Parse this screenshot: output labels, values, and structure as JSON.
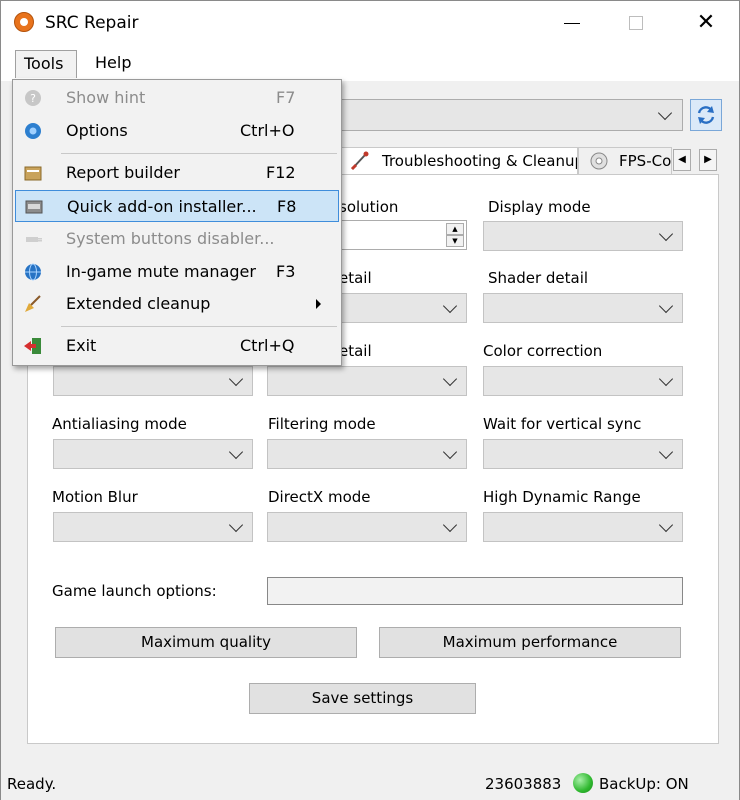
{
  "window": {
    "title": "SRC Repair"
  },
  "menubar": {
    "tools": "Tools",
    "help": "Help"
  },
  "tabs": {
    "troubleshooting": "Troubleshooting & Cleanup",
    "fps": "FPS-Co"
  },
  "tools_menu": {
    "items": [
      {
        "label": "Show hint",
        "shortcut": "F7",
        "enabled": false,
        "icon": "hint-icon"
      },
      {
        "label": "Options",
        "shortcut": "Ctrl+O",
        "enabled": true,
        "icon": "options-icon"
      },
      {
        "label": "Report builder",
        "shortcut": "F12",
        "enabled": true,
        "icon": "report-icon"
      },
      {
        "label": "Quick add-on installer...",
        "shortcut": "F8",
        "enabled": true,
        "highlighted": true,
        "icon": "installer-icon"
      },
      {
        "label": "System buttons disabler...",
        "shortcut": "",
        "enabled": false,
        "icon": "plug-icon"
      },
      {
        "label": "In-game mute manager",
        "shortcut": "F3",
        "enabled": true,
        "icon": "globe-icon"
      },
      {
        "label": "Extended cleanup",
        "shortcut": "",
        "enabled": true,
        "has_submenu": true,
        "icon": "broom-icon"
      },
      {
        "label": "Exit",
        "shortcut": "Ctrl+Q",
        "enabled": true,
        "icon": "exit-icon"
      }
    ]
  },
  "settings": {
    "resolution_label": "solution",
    "display_mode_label": "Display mode",
    "model_detail_label": "etail",
    "shader_detail_label": "Shader detail",
    "water_detail_label": "etail",
    "color_correction_label": "Color correction",
    "antialiasing_label": "Antialiasing mode",
    "filtering_label": "Filtering mode",
    "vsync_label": "Wait for vertical sync",
    "motion_blur_label": "Motion Blur",
    "directx_label": "DirectX mode",
    "hdr_label": "High Dynamic Range",
    "launch_options_label": "Game launch options:",
    "launch_options_value": ""
  },
  "buttons": {
    "max_quality": "Maximum quality",
    "max_performance": "Maximum performance",
    "save": "Save settings"
  },
  "status": {
    "ready": "Ready.",
    "number": "23603883",
    "backup": "BackUp: ON",
    "backup_color": "#2fb82f"
  },
  "colors": {
    "highlight": "#cce4f7",
    "highlight_border": "#3f8ddb"
  }
}
